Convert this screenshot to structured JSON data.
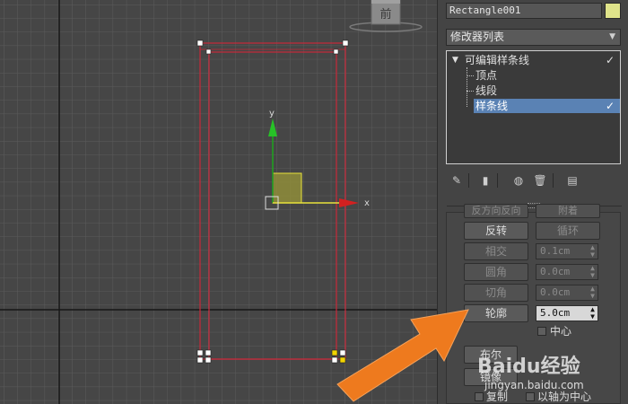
{
  "viewport": {
    "viewcube_label": "前",
    "axis_y": "y",
    "axis_x": "x"
  },
  "panel": {
    "object_name": "Rectangle001",
    "object_color": "#dfe38a",
    "modifier_list": "修改器列表",
    "stack": {
      "root": "可编辑样条线",
      "children": [
        "顶点",
        "线段",
        "样条线"
      ],
      "selected_index": 2
    },
    "buttons": {
      "cut_off_top": "反方向反向",
      "cut_off_top_right": "附着",
      "reverse": "反转",
      "cycle": "循环",
      "intersect": "相交",
      "fillet": "圆角",
      "chamfer": "切角",
      "outline": "轮廓",
      "bool": "布尔",
      "mirror": "镜像"
    },
    "spinners": {
      "intersect_value": "0.1cm",
      "fillet_value": "0.0cm",
      "chamfer_value": "0.0cm",
      "outline_value": "5.0cm"
    },
    "checkboxes": {
      "center": "中心",
      "copy": "复制",
      "about_pivot": "以轴为中心"
    }
  },
  "watermark": {
    "brand": "Baidu经验",
    "url": "jingyan.baidu.com"
  },
  "colors": {
    "selection_blue": "#5a82b4",
    "spline_red": "#c8283a",
    "arrow_orange": "#ee7a1e"
  }
}
